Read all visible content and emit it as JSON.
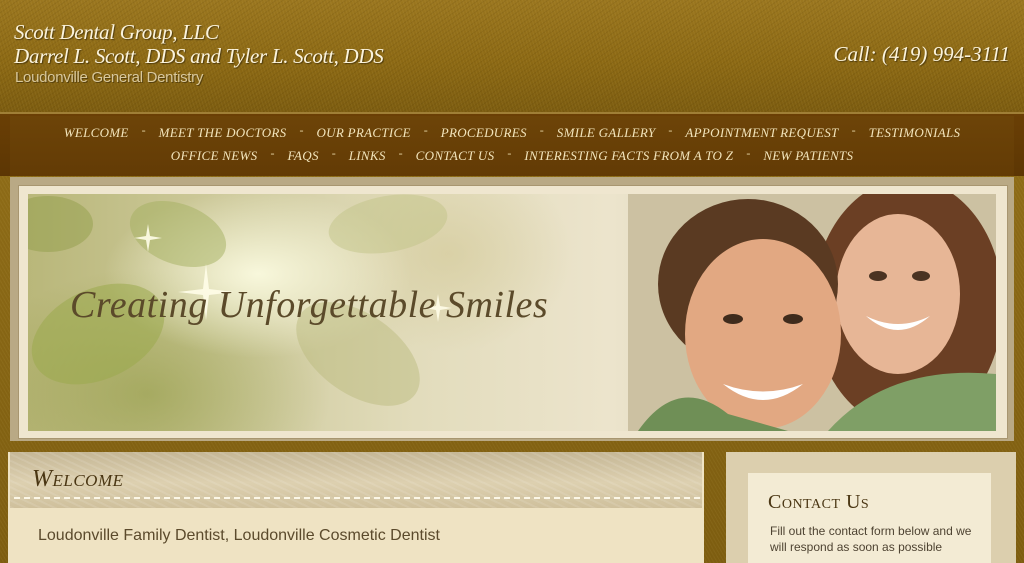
{
  "header": {
    "line1": "Scott Dental Group, LLC",
    "line2": "Darrel L. Scott, DDS and Tyler L. Scott, DDS",
    "subtitle": "Loudonville General Dentistry",
    "phone": "Call: (419) 994-3111"
  },
  "nav": {
    "separator": "-",
    "row1": [
      {
        "label": "WELCOME"
      },
      {
        "label": "MEET THE DOCTORS"
      },
      {
        "label": "OUR PRACTICE"
      },
      {
        "label": "PROCEDURES"
      },
      {
        "label": "SMILE GALLERY"
      },
      {
        "label": "APPOINTMENT REQUEST"
      },
      {
        "label": "TESTIMONIALS"
      }
    ],
    "row2": [
      {
        "label": "OFFICE NEWS"
      },
      {
        "label": "FAQS"
      },
      {
        "label": "LINKS"
      },
      {
        "label": "CONTACT US"
      },
      {
        "label": "INTERESTING FACTS FROM A TO Z"
      },
      {
        "label": "NEW PATIENTS"
      }
    ]
  },
  "banner": {
    "tagline": "Creating Unforgettable Smiles"
  },
  "welcome": {
    "title": "Welcome",
    "subtitle": "Loudonville Family Dentist, Loudonville Cosmetic Dentist"
  },
  "sidebar": {
    "contact_title": "Contact Us",
    "contact_text": "Fill out the contact form below and we will respond as soon as possible"
  },
  "colors": {
    "header_gold": "#8c6914",
    "nav_brown": "#633b05",
    "panel_cream": "#efe3c3",
    "title_brown": "#4a3613"
  }
}
